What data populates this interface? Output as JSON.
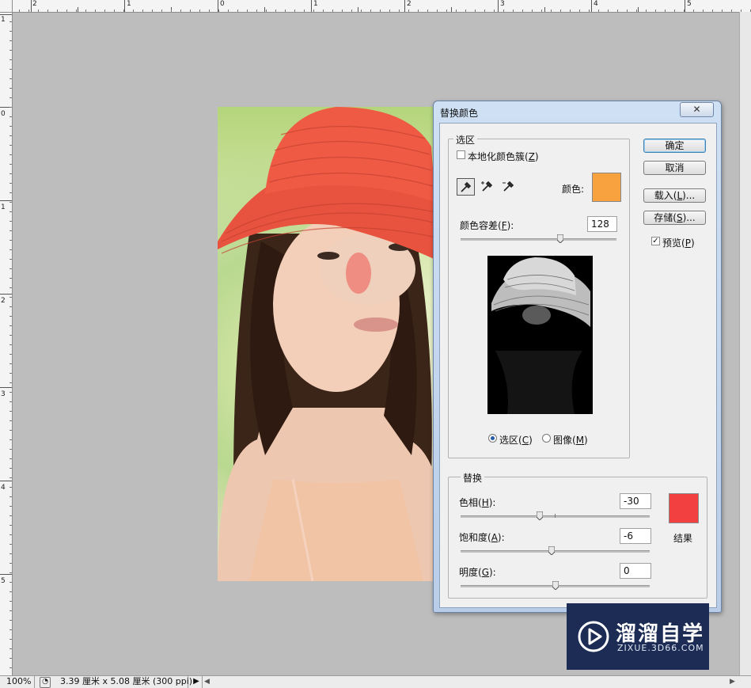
{
  "rulers": {
    "top_labels": [
      "2",
      "1",
      "0",
      "1",
      "2",
      "3",
      "4",
      "5"
    ],
    "left_labels": [
      "1",
      "0",
      "1",
      "2",
      "3",
      "4",
      "5"
    ]
  },
  "status": {
    "zoom": "100%",
    "doc_info": "3.39 厘米 x 5.08 厘米 (300 ppi)",
    "arrow": "▶"
  },
  "dialog": {
    "title": "替换颜色",
    "close_glyph": "✕",
    "selection": {
      "legend": "选区",
      "localized_clusters": {
        "label": "本地化颜色簇(",
        "key": "Z",
        "end": ")",
        "checked": false
      },
      "color_label": "颜色:",
      "color_value": "#f7a23e",
      "fuzziness_label": "颜色容差(",
      "fuzziness_key": "F",
      "fuzziness_end": "):",
      "fuzziness_value": "128",
      "fuzziness_slider": 0.64,
      "radio_selection": {
        "label": "选区(",
        "key": "C",
        "end": ")",
        "selected": true
      },
      "radio_image": {
        "label": "图像(",
        "key": "M",
        "end": ")",
        "selected": false
      }
    },
    "buttons": {
      "ok": "确定",
      "cancel": "取消",
      "load_label": "载入(",
      "load_key": "L",
      "load_end": ")...",
      "save_label": "存储(",
      "save_key": "S",
      "save_end": ")..."
    },
    "preview_check": {
      "label": "预览(",
      "key": "P",
      "end": ")",
      "checked": true
    },
    "replacement": {
      "legend": "替换",
      "hue_label": "色相(",
      "hue_key": "H",
      "hue_end": "):",
      "hue_value": "-30",
      "hue_slider": 0.42,
      "sat_label": "饱和度(",
      "sat_key": "A",
      "sat_end": "):",
      "sat_value": "-6",
      "sat_slider": 0.48,
      "light_label": "明度(",
      "light_key": "G",
      "light_end": "):",
      "light_value": "0",
      "light_slider": 0.5,
      "result_label": "结果",
      "result_color": "#f24040"
    }
  },
  "watermark": {
    "brand": "溜溜自学",
    "url": "ZIXUE.3D66.COM"
  }
}
